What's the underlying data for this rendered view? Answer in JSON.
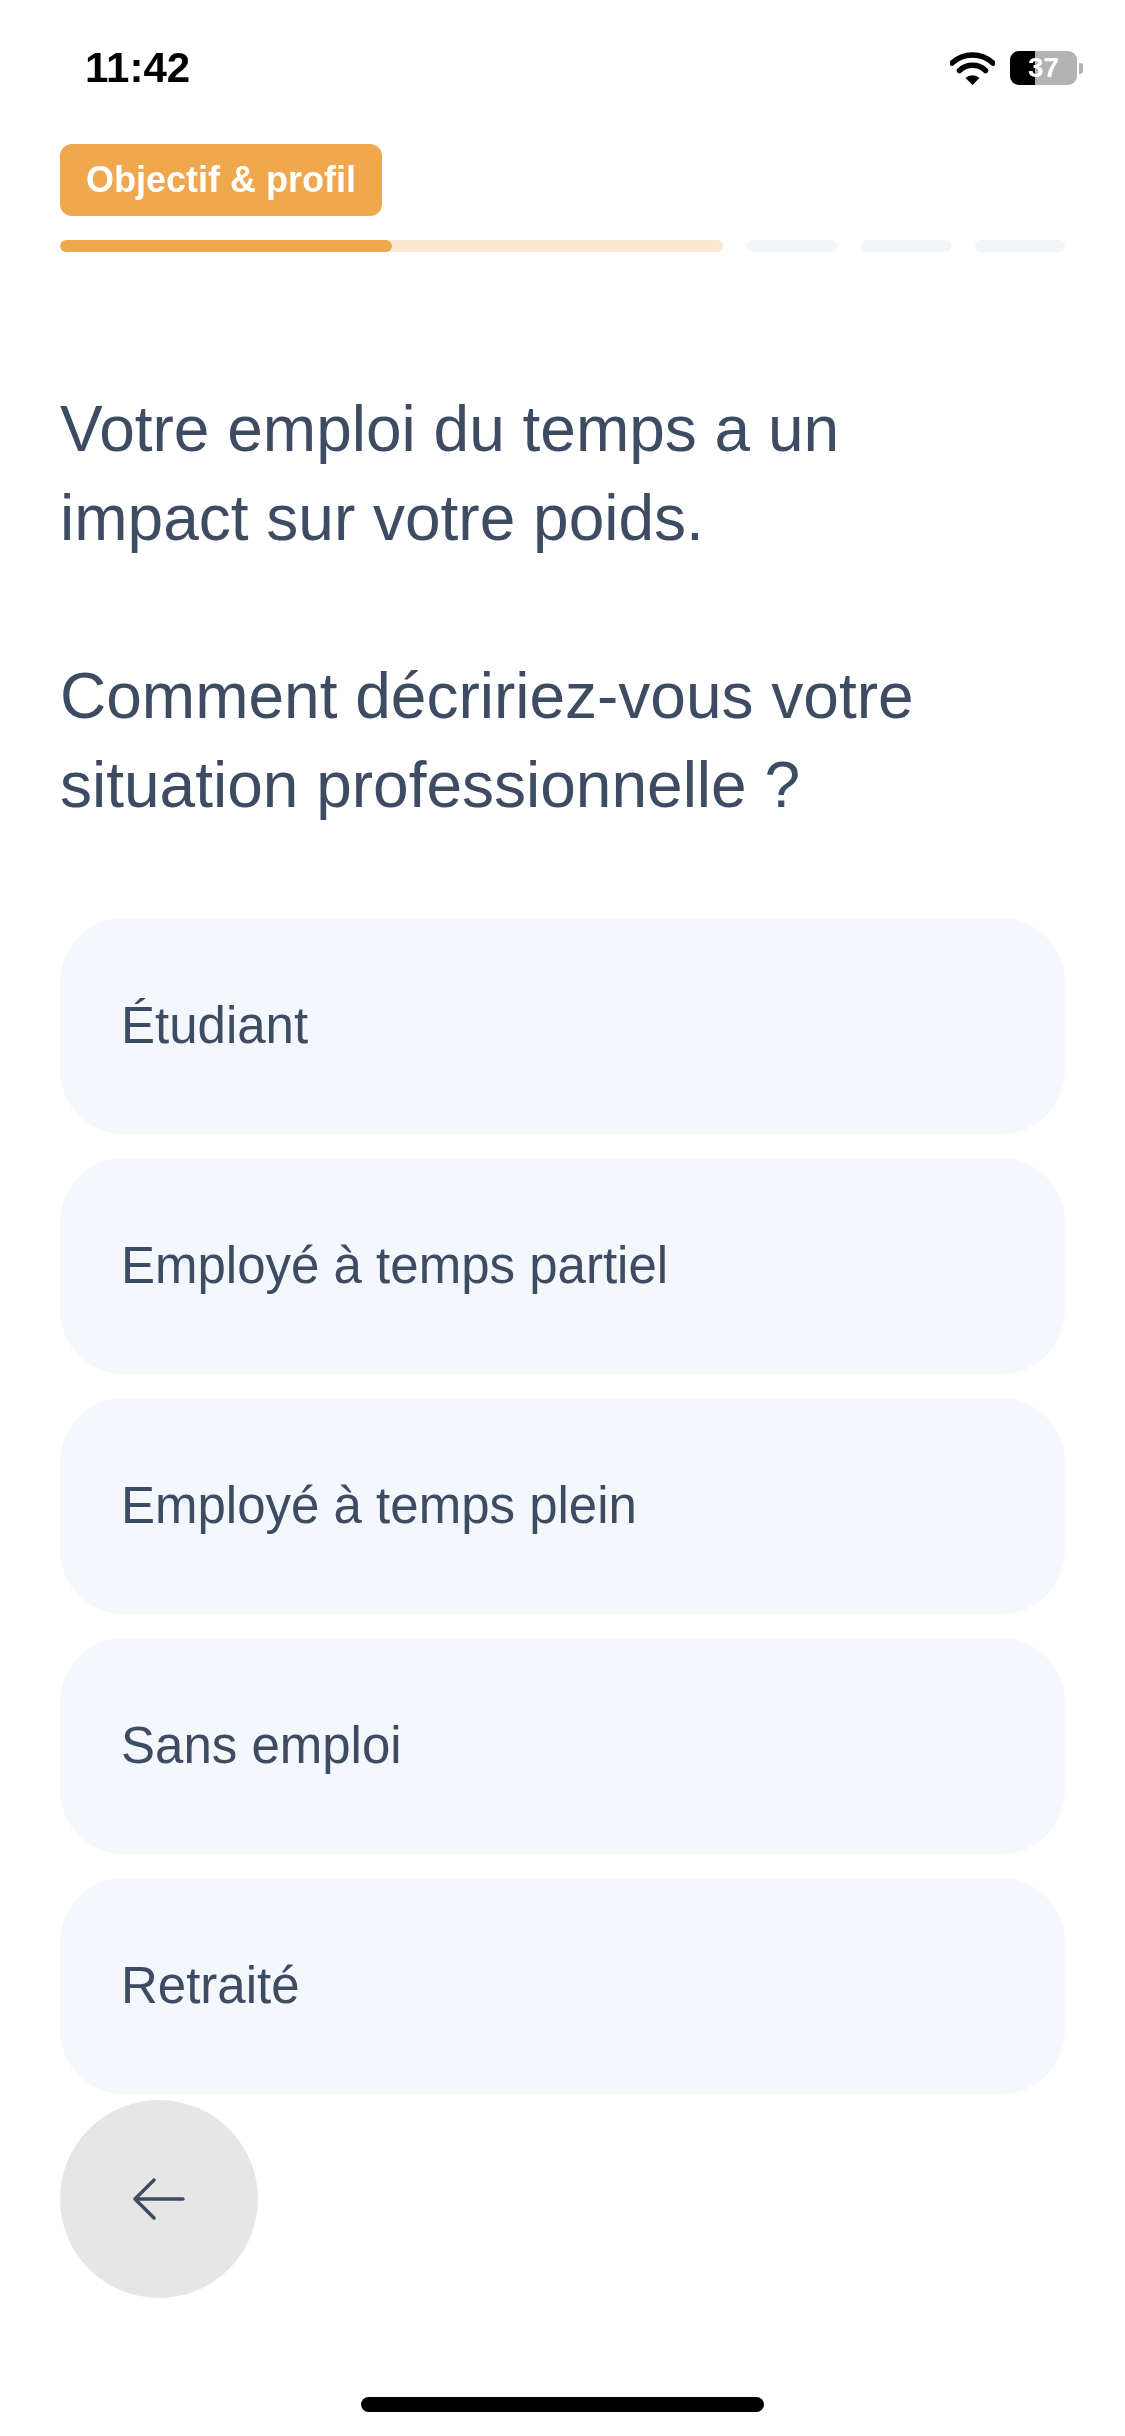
{
  "status_bar": {
    "time": "11:42",
    "battery": "37"
  },
  "progress": {
    "section_label": "Objectif & profil",
    "segments": [
      {
        "active": true,
        "level": 0.5
      },
      {
        "active": false
      },
      {
        "active": false
      },
      {
        "active": false
      }
    ]
  },
  "question": {
    "paragraphs": [
      "Votre emploi du temps a un impact sur votre poids.",
      "Comment décririez-vous votre situation professionnelle ?"
    ]
  },
  "options": [
    {
      "label": "Étudiant",
      "selected": false
    },
    {
      "label": "Employé à temps partiel",
      "selected": false
    },
    {
      "label": "Employé à temps plein",
      "selected": false
    },
    {
      "label": "Sans emploi",
      "selected": false
    },
    {
      "label": "Retraité",
      "selected": false
    }
  ]
}
